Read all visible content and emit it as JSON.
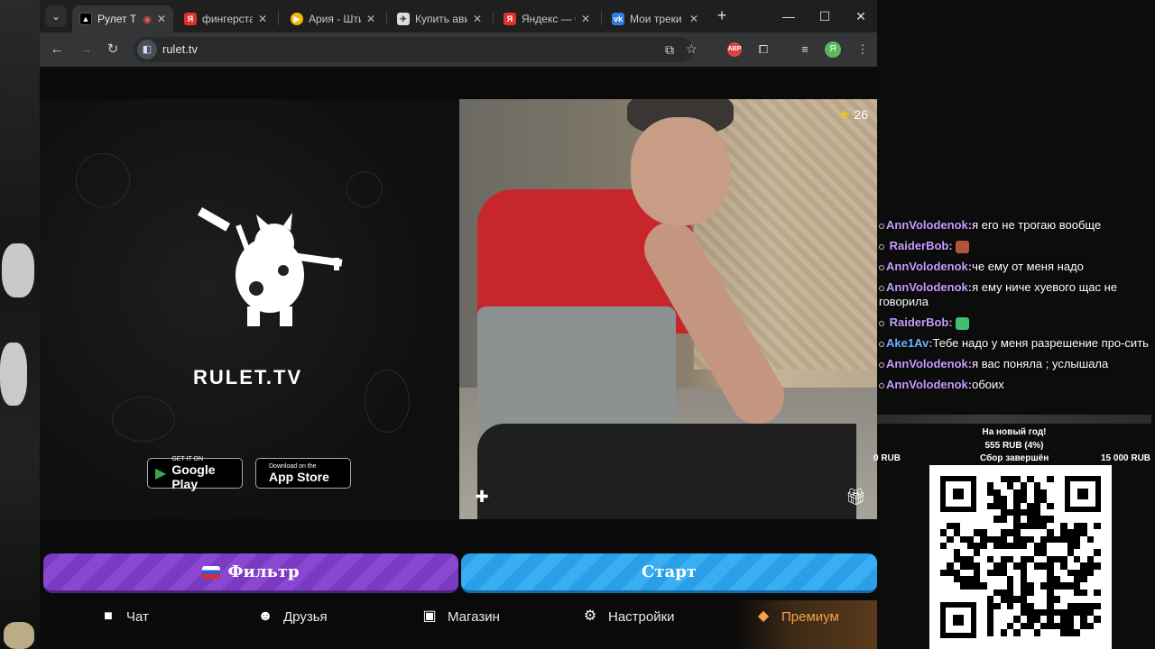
{
  "browser": {
    "tabs": [
      {
        "title": "Рулет ТВ",
        "favicon": "rulet-icon",
        "color": "#222222",
        "active": true
      },
      {
        "title": "фингерстайл",
        "favicon": "yandex-icon",
        "color": "#e03030"
      },
      {
        "title": "Ария - Шти",
        "favicon": "play-icon",
        "color": "#f2b900"
      },
      {
        "title": "Купить ави",
        "favicon": "aviasales-icon",
        "color": "#444444"
      },
      {
        "title": "Яндекс — б",
        "favicon": "yandex-icon",
        "color": "#e03030"
      },
      {
        "title": "Мои треки",
        "favicon": "vk-icon",
        "color": "#2f7de1"
      }
    ],
    "url": "rulet.tv",
    "profile_letter": "Я",
    "abp_label": "ABP"
  },
  "page": {
    "brand": "RULET.TV",
    "google_play": {
      "small": "GET IT ON",
      "big": "Google Play"
    },
    "app_store": {
      "small": "Download on the",
      "big": "App Store"
    },
    "rating": "26",
    "filter_label": "Фильтр",
    "start_label": "Старт",
    "nav": [
      {
        "label": "Чат",
        "icon": "chat-icon"
      },
      {
        "label": "Друзья",
        "icon": "friends-icon"
      },
      {
        "label": "Магазин",
        "icon": "shop-icon"
      },
      {
        "label": "Настройки",
        "icon": "gear-icon"
      },
      {
        "label": "Премиум",
        "icon": "tag-icon"
      }
    ]
  },
  "chat": [
    {
      "nick": "AnnVolodenok:",
      "text": "я его не трогаю вообще",
      "color": "purple"
    },
    {
      "nick": "RaiderBob:",
      "text": "",
      "emote": "#b5523c"
    },
    {
      "nick": "AnnVolodenok:",
      "text": "че ему от меня надо",
      "color": "purple"
    },
    {
      "nick": "AnnVolodenok:",
      "text": "я ему ниче хуевого щас не говорила",
      "color": "purple"
    },
    {
      "nick": "RaiderBob:",
      "text": "",
      "emote": "#3fbf6f"
    },
    {
      "nick": "Ake1Av:",
      "text": "Тебе надо у меня разрешение про-сить",
      "color": "blue"
    },
    {
      "nick": "AnnVolodenok:",
      "text": "я вас поняла ; услышала",
      "color": "purple"
    },
    {
      "nick": "AnnVolodenok:",
      "text": "обоих",
      "color": "purple"
    }
  ],
  "donation": {
    "title": "На новый год!",
    "amount": "555 RUB (4%)",
    "progress": 0.04,
    "min": "0 RUB",
    "status": "Сбор завершён",
    "max": "15 000 RUB"
  }
}
